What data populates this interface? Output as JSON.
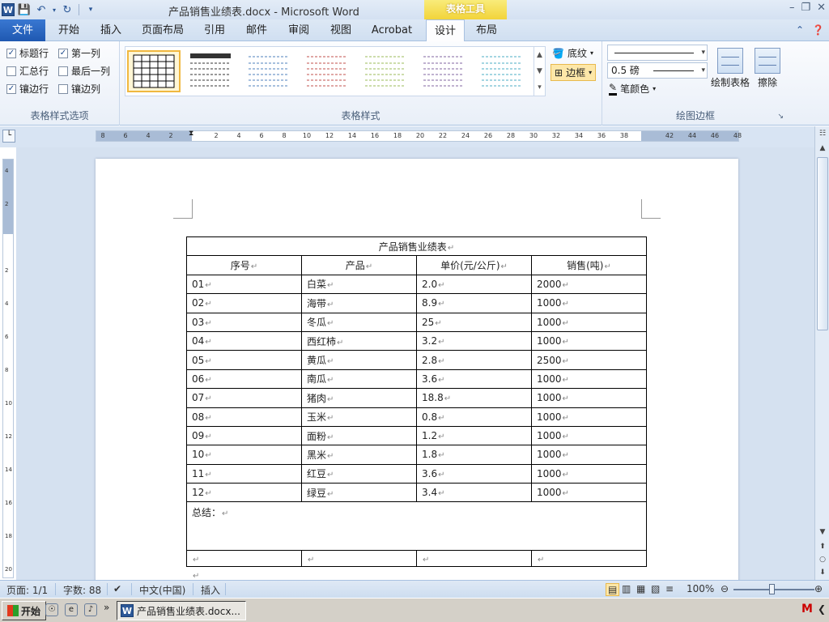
{
  "window": {
    "title": "产品销售业绩表.docx - Microsoft Word",
    "context_tab": "表格工具",
    "app_icon": "W"
  },
  "tabs": {
    "file": "文件",
    "items": [
      "开始",
      "插入",
      "页面布局",
      "引用",
      "邮件",
      "审阅",
      "视图",
      "Acrobat",
      "设计",
      "布局"
    ],
    "active": "设计"
  },
  "ribbon": {
    "style_options": {
      "label": "表格样式选项",
      "checks": [
        {
          "label": "标题行",
          "checked": true
        },
        {
          "label": "第一列",
          "checked": true
        },
        {
          "label": "汇总行",
          "checked": false
        },
        {
          "label": "最后一列",
          "checked": false
        },
        {
          "label": "镶边行",
          "checked": true
        },
        {
          "label": "镶边列",
          "checked": false
        }
      ]
    },
    "table_styles": {
      "label": "表格样式",
      "swatch_colors": [
        "#000000",
        "#333333",
        "#4f81bd",
        "#c0504d",
        "#9bbb59",
        "#8064a2",
        "#4bacc6"
      ]
    },
    "shading_label": "底纹",
    "borders_label": "边框",
    "draw_borders": {
      "label": "绘图边框",
      "line_weight": "0.5 磅",
      "pen_color": "笔颜色",
      "draw_table": "绘制表格",
      "eraser": "擦除"
    }
  },
  "ruler": {
    "h_ticks": [
      "8",
      "6",
      "4",
      "2",
      "",
      "2",
      "4",
      "6",
      "8",
      "10",
      "12",
      "14",
      "16",
      "18",
      "20",
      "22",
      "24",
      "26",
      "28",
      "30",
      "32",
      "34",
      "36",
      "38",
      "",
      "42",
      "44",
      "46",
      "48"
    ],
    "v_ticks": [
      "4",
      "2",
      "",
      "2",
      "4",
      "6",
      "8",
      "10",
      "12",
      "14",
      "16",
      "18",
      "20"
    ]
  },
  "document": {
    "table_title": "产品销售业绩表",
    "headers": [
      "序号",
      "产品",
      "单价(元/公斤)",
      "销售(吨)"
    ],
    "rows": [
      [
        "01",
        "白菜",
        "2.0",
        "2000"
      ],
      [
        "02",
        "海带",
        "8.9",
        "1000"
      ],
      [
        "03",
        "冬瓜",
        "25",
        "1000"
      ],
      [
        "04",
        "西红柿",
        "3.2",
        "1000"
      ],
      [
        "05",
        "黄瓜",
        "2.8",
        "2500"
      ],
      [
        "06",
        "南瓜",
        "3.6",
        "1000"
      ],
      [
        "07",
        "猪肉",
        "18.8",
        "1000"
      ],
      [
        "08",
        "玉米",
        "0.8",
        "1000"
      ],
      [
        "09",
        "面粉",
        "1.2",
        "1000"
      ],
      [
        "10",
        "黑米",
        "1.8",
        "1000"
      ],
      [
        "11",
        "红豆",
        "3.6",
        "1000"
      ],
      [
        "12",
        "绿豆",
        "3.4",
        "1000"
      ]
    ],
    "summary_label": "总结：",
    "para_mark": "↵"
  },
  "statusbar": {
    "page": "页面: 1/1",
    "words": "字数: 88",
    "language": "中文(中国)",
    "mode": "插入",
    "zoom": "100%"
  },
  "taskbar": {
    "start": "开始",
    "task": "产品销售业绩表.docx..."
  }
}
